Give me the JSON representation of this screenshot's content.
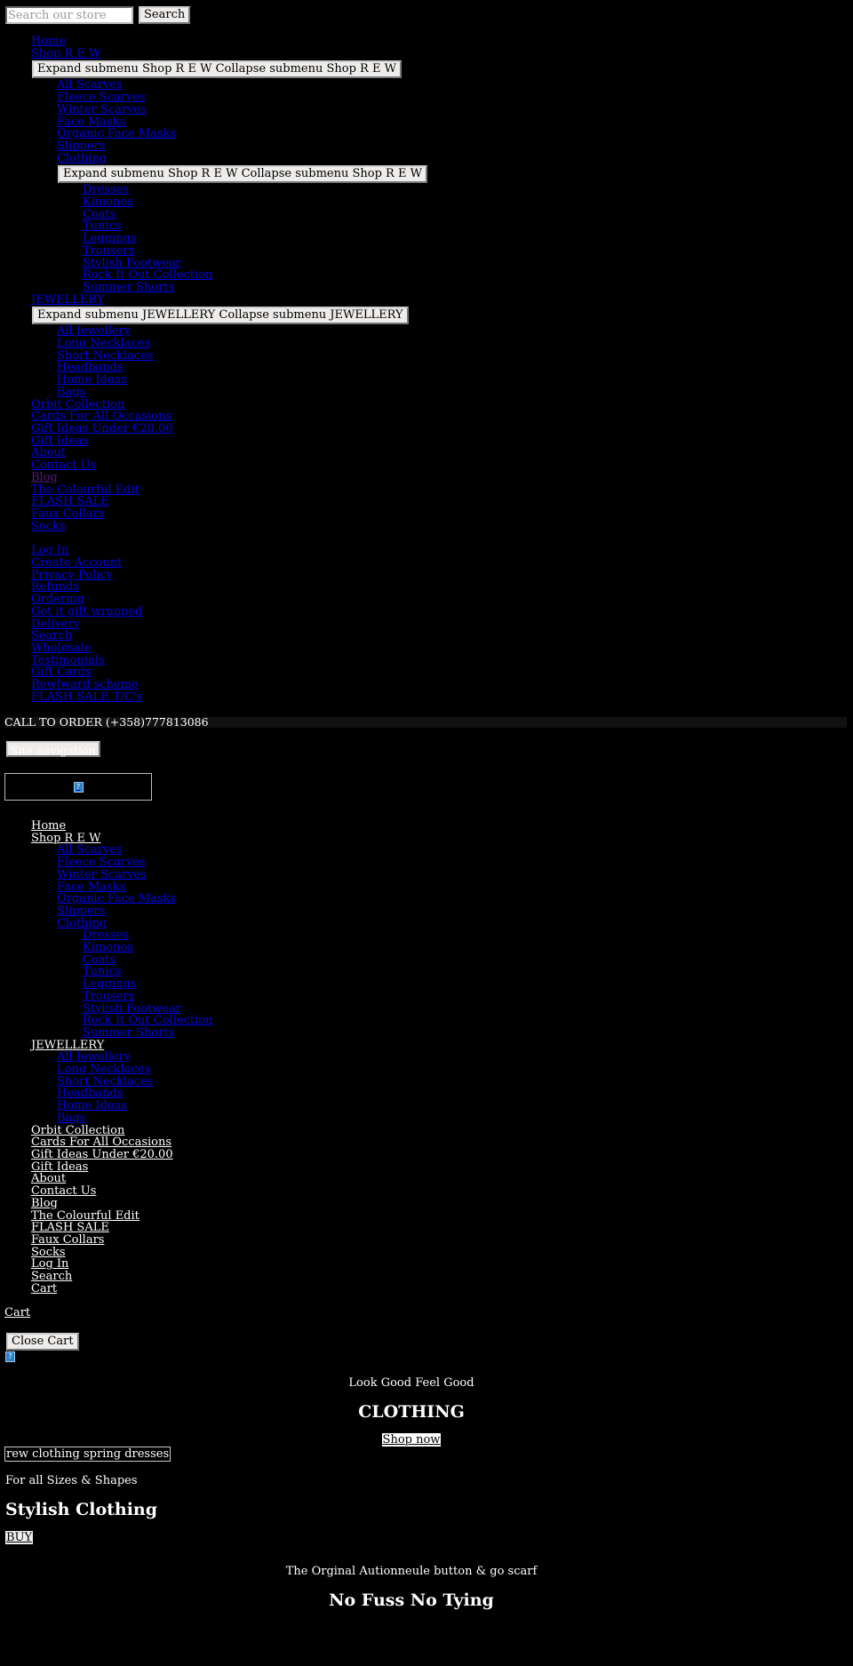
{
  "search": {
    "placeholder": "Search our store",
    "button": "Search"
  },
  "menu_toggles": {
    "shop": "Expand submenu Shop R E W Collapse submenu Shop R E W",
    "clothing": "Expand submenu Shop R E W Collapse submenu Shop R E W",
    "jewellery": "Expand submenu JEWELLERY Collapse submenu JEWELLERY"
  },
  "nav": {
    "home": "Home",
    "shop": "Shop R E W",
    "shop_items": [
      "All Scarves",
      "Fleece Scarves",
      "Winter Scarves",
      "Face Masks",
      "Organic Face Masks",
      "Slippers"
    ],
    "clothing": "Clothing",
    "clothing_items": [
      "Dresses",
      "Kimonos",
      "Coats",
      "Tunics",
      "Leggings",
      "Trousers",
      "Stylish Footwear",
      "Rock It Out Collection",
      "Summer Shorts"
    ],
    "jewellery": "JEWELLERY",
    "jewellery_items": [
      "All Jewellery",
      "Long Necklaces",
      "Short Necklaces",
      "Headbands",
      "Home Ideas",
      "Bags"
    ],
    "top_items": [
      "Orbit Collection",
      "Cards For All Occasions",
      "Gift Ideas Under €20.00",
      "Gift Ideas",
      "About",
      "Contact Us",
      "Blog",
      "The Colourful Edit",
      "FLASH SALE",
      "Faux Collars",
      "Socks"
    ]
  },
  "footer_links": [
    "Log In",
    "Create Account",
    "Privacy Policy",
    "Refunds",
    "Ordering",
    "Get it gift wrapped",
    "Delivery",
    "Search",
    "Wholesale",
    "Testimonials",
    "Gift Cards",
    "Rew|ward scheme",
    "FLASH SALE T/C's"
  ],
  "call_bar": "CALL TO ORDER (+358)777813086",
  "site_nav_button": "Site navigation",
  "broken_image_glyph": "?",
  "nav2_extra": [
    "Log In",
    "Search",
    "Cart"
  ],
  "cart": {
    "link": "Cart",
    "close": "Close Cart"
  },
  "hero1": {
    "kicker": "Look Good Feel Good",
    "title": "CLOTHING",
    "cta": "Shop now"
  },
  "image_alt": "rew clothing spring dresses",
  "hero2": {
    "kicker": "For all Sizes & Shapes",
    "title": "Stylish Clothing",
    "cta": "BUY"
  },
  "hero3": {
    "kicker": "The Orginal Autionneule button & go scarf",
    "title": "No Fuss No Tying"
  }
}
